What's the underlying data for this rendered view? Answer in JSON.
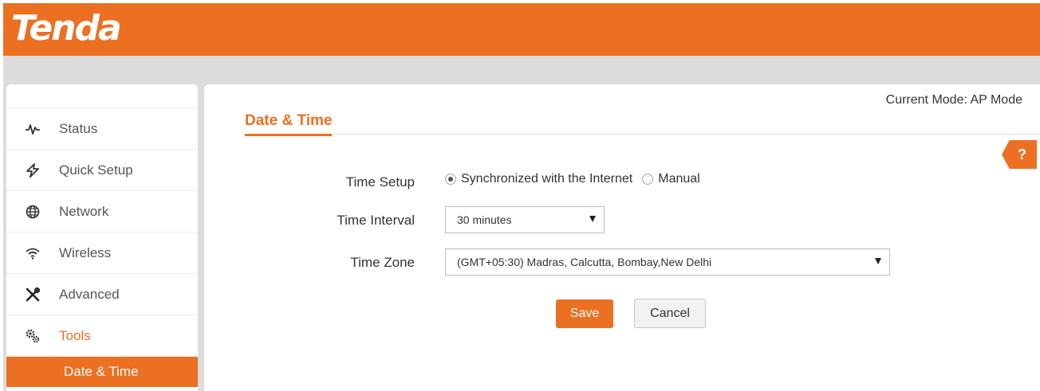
{
  "header": {
    "logo_text": "Tenda",
    "brand_color": "#ec7022"
  },
  "sidebar": {
    "items": [
      {
        "label": "Status",
        "icon": "pulse-icon"
      },
      {
        "label": "Quick Setup",
        "icon": "lightning-icon"
      },
      {
        "label": "Network",
        "icon": "globe-icon"
      },
      {
        "label": "Wireless",
        "icon": "wifi-icon"
      },
      {
        "label": "Advanced",
        "icon": "tools-icon"
      },
      {
        "label": "Tools",
        "icon": "gears-icon",
        "active": true
      }
    ],
    "subitem": {
      "label": "Date & Time",
      "selected": true
    }
  },
  "main": {
    "current_mode": "Current Mode: AP Mode",
    "page_title": "Date & Time",
    "help_label": "?",
    "form": {
      "time_setup": {
        "label": "Time Setup",
        "options": [
          "Synchronized with the Internet",
          "Manual"
        ],
        "selected": "Synchronized with the Internet"
      },
      "time_interval": {
        "label": "Time Interval",
        "value": "30 minutes"
      },
      "time_zone": {
        "label": "Time Zone",
        "value": "(GMT+05:30) Madras, Calcutta, Bombay,New Delhi"
      }
    },
    "buttons": {
      "save": "Save",
      "cancel": "Cancel"
    }
  }
}
